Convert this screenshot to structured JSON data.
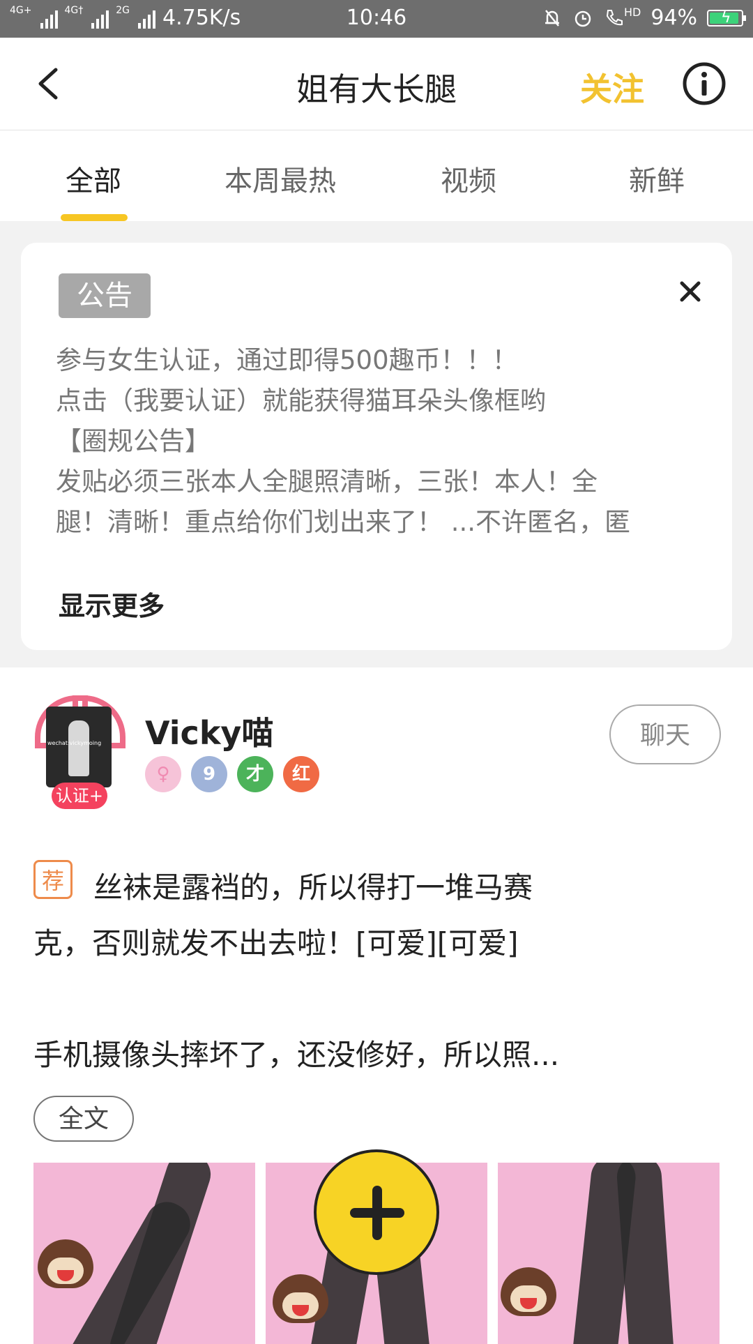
{
  "status_bar": {
    "network_a": "4G+",
    "network_b": "4G†",
    "network_c": "2G",
    "speed": "4.75K/s",
    "time": "10:46",
    "hd": "HD",
    "battery": "94%",
    "battery_level": 0.94
  },
  "header": {
    "title": "姐有大长腿",
    "follow_label": "关注"
  },
  "tabs": [
    {
      "label": "全部"
    },
    {
      "label": "本周最热"
    },
    {
      "label": "视频"
    },
    {
      "label": "新鲜"
    }
  ],
  "notice": {
    "badge": "公告",
    "lines": [
      "参与女生认证，通过即得500趣币！！！",
      "点击（我要认证）就能获得猫耳朵头像框哟",
      "【圈规公告】",
      "发贴必须三张本人全腿照清晰，三张！本人！全",
      "腿！清晰！重点给你们划出来了！ ...不许匿名，匿"
    ],
    "show_more": "显示更多"
  },
  "post": {
    "username": "Vicky喵",
    "avatar_caption": "wechat:vickymoing",
    "cert_label": "认证+",
    "medals": [
      "♀",
      "9",
      "才",
      "红"
    ],
    "chat_label": "聊天",
    "rec_tag": "荐",
    "text_lines": [
      "丝袜是露裆的，所以得打一堆马赛",
      "克，否则就发不出去啦！[可爱][可爱]",
      "",
      "手机摄像头摔坏了，还没修好，所以照..."
    ],
    "full_text_label": "全文"
  },
  "colors": {
    "accent_yellow": "#f7c623",
    "follow": "#f2c230",
    "badge_gray": "#a8a8a8",
    "cert_red": "#f4425e",
    "rec_orange": "#ee8b4b"
  }
}
